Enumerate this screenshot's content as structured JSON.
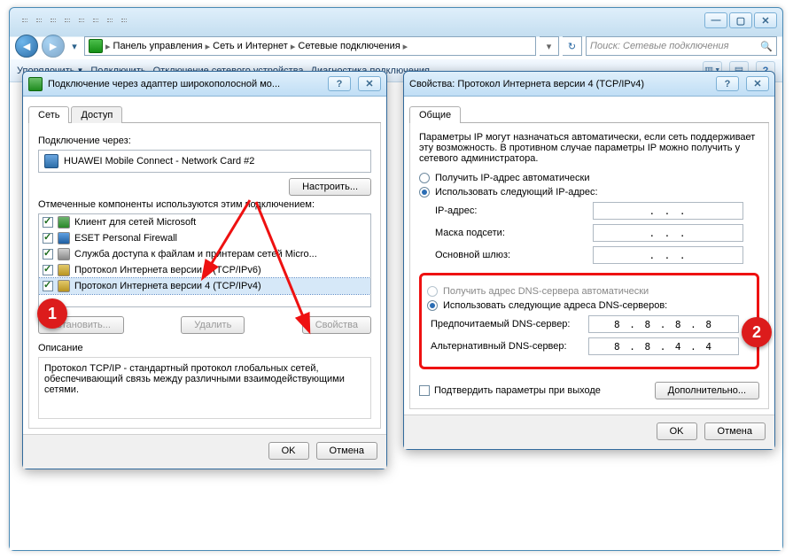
{
  "explorer": {
    "breadcrumb": [
      "Панель управления",
      "Сеть и Интернет",
      "Сетевые подключения"
    ],
    "search_placeholder": "Поиск: Сетевые подключения",
    "toolbar": {
      "organize": "Упорядочить",
      "disconnect": "Подключить",
      "disable": "Отключение сетевого устройства",
      "diagnose": "Диагностика подключения"
    }
  },
  "dlg_left": {
    "title": "Подключение через адаптер широкополосной мо...",
    "tabs": {
      "net": "Сеть",
      "access": "Доступ"
    },
    "connect_via": "Подключение через:",
    "adapter": "HUAWEI Mobile Connect - Network Card #2",
    "configure": "Настроить...",
    "components_label": "Отмеченные компоненты используются этим подключением:",
    "items": [
      "Клиент для сетей Microsoft",
      "ESET Personal Firewall",
      "Служба доступа к файлам и принтерам сетей Micro...",
      "Протокол Интернета версии 6 (TCP/IPv6)",
      "Протокол Интернета версии 4 (TCP/IPv4)"
    ],
    "install": "Установить...",
    "remove": "Удалить",
    "properties": "Свойства",
    "desc_title": "Описание",
    "description": "Протокол TCP/IP - стандартный протокол глобальных сетей, обеспечивающий связь между различными взаимодействующими сетями.",
    "ok": "OK",
    "cancel": "Отмена"
  },
  "dlg_right": {
    "title": "Свойства: Протокол Интернета версии 4 (TCP/IPv4)",
    "tab": "Общие",
    "intro": "Параметры IP могут назначаться автоматически, если сеть поддерживает эту возможность. В противном случае параметры IP можно получить у сетевого администратора.",
    "ip_auto": "Получить IP-адрес автоматически",
    "ip_manual": "Использовать следующий IP-адрес:",
    "ip_label": "IP-адрес:",
    "mask_label": "Маска подсети:",
    "gw_label": "Основной шлюз:",
    "ip_value": " .   .   . ",
    "mask_value": " .   .   . ",
    "gw_value": " .   .   . ",
    "dns_auto": "Получить адрес DNS-сервера автоматически",
    "dns_manual": "Использовать следующие адреса DNS-серверов:",
    "dns1_label": "Предпочитаемый DNS-сервер:",
    "dns2_label": "Альтернативный DNS-сервер:",
    "dns1": "8 . 8 . 8 . 8",
    "dns2": "8 . 8 . 4 . 4",
    "confirm_exit": "Подтвердить параметры при выходе",
    "advanced": "Дополнительно...",
    "ok": "OK",
    "cancel": "Отмена"
  },
  "badges": {
    "b1": "1",
    "b2": "2"
  }
}
